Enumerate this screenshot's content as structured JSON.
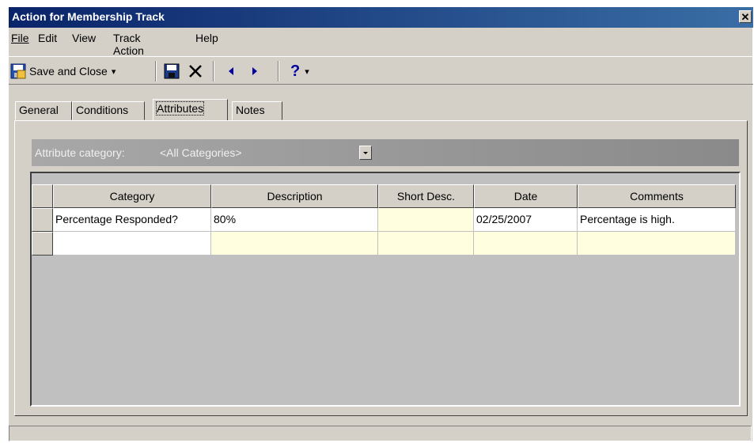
{
  "window": {
    "title": "Action for Membership Track",
    "close_glyph": "✕"
  },
  "menu": [
    {
      "label": "File"
    },
    {
      "label": "Edit"
    },
    {
      "label": "View"
    },
    {
      "label": "Track Action"
    },
    {
      "label": "Help"
    }
  ],
  "toolbar": {
    "save_close_label": "Save and Close",
    "save_close_icon": "save-close-icon",
    "save_icon": "floppy-disk-icon",
    "delete_icon": "x-delete-icon",
    "prev_icon": "triangle-left-icon",
    "next_icon": "triangle-right-icon",
    "help_label": "?",
    "dropdown_glyph": "▾"
  },
  "tabs": [
    {
      "label": "General",
      "active": false
    },
    {
      "label": "Conditions",
      "active": false
    },
    {
      "label": "Attributes",
      "active": true
    },
    {
      "label": "Notes",
      "active": false
    }
  ],
  "attribute_filter": {
    "label": "Attribute category:",
    "value": "<All Categories>"
  },
  "grid": {
    "columns": [
      "Category",
      "Description",
      "Short Desc.",
      "Date",
      "Comments"
    ],
    "rows": [
      {
        "category": "Percentage Responded?",
        "description": "80%",
        "short_desc": "",
        "date": "02/25/2007",
        "comments": "Percentage is high."
      },
      {
        "category": "",
        "description": "",
        "short_desc": "",
        "date": "",
        "comments": ""
      }
    ]
  },
  "colors": {
    "title_bar_start": "#0a246a",
    "title_bar_end": "#3a6ea5",
    "window_face": "#d4d0c8",
    "new_row": "#ffffe0"
  }
}
